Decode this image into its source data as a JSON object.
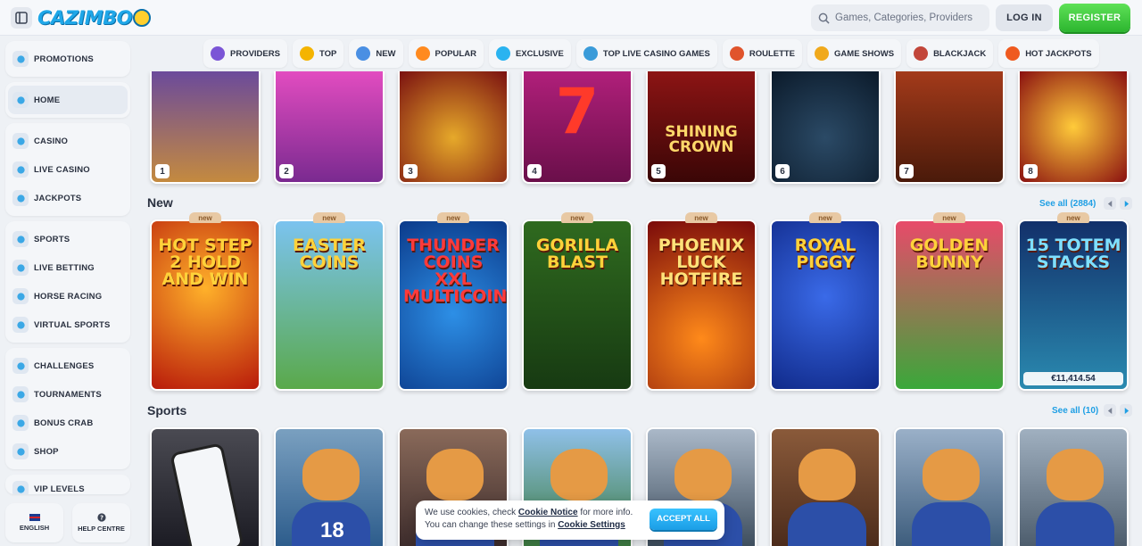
{
  "header": {
    "logo": "CAZIMBO",
    "search_placeholder": "Games, Categories, Providers",
    "login": "LOG IN",
    "register": "REGISTER"
  },
  "sidebar": {
    "groups": [
      [
        {
          "label": "PROMOTIONS",
          "icon": "gift-icon"
        }
      ],
      [
        {
          "label": "HOME",
          "icon": "home-icon",
          "active": true
        }
      ],
      [
        {
          "label": "CASINO",
          "icon": "slot-machine-icon"
        },
        {
          "label": "LIVE CASINO",
          "icon": "dealer-icon"
        },
        {
          "label": "JACKPOTS",
          "icon": "jackpot-icon"
        }
      ],
      [
        {
          "label": "SPORTS",
          "icon": "ball-icon"
        },
        {
          "label": "LIVE BETTING",
          "icon": "play-icon"
        },
        {
          "label": "HORSE RACING",
          "icon": "horse-icon"
        },
        {
          "label": "VIRTUAL SPORTS",
          "icon": "gamepad-icon"
        }
      ],
      [
        {
          "label": "CHALLENGES",
          "icon": "target-icon"
        },
        {
          "label": "TOURNAMENTS",
          "icon": "trophy-icon"
        },
        {
          "label": "BONUS CRAB",
          "icon": "crab-icon"
        },
        {
          "label": "SHOP",
          "icon": "shop-icon"
        }
      ],
      [
        {
          "label": "VIP LEVELS",
          "icon": "crown-icon"
        }
      ]
    ],
    "language": "ENGLISH",
    "help": "HELP CENTRE"
  },
  "categories": [
    {
      "label": "PROVIDERS",
      "color": "#7b55d6"
    },
    {
      "label": "TOP",
      "color": "#f4b400"
    },
    {
      "label": "NEW",
      "color": "#4a8fe3"
    },
    {
      "label": "POPULAR",
      "color": "#ff8a1f"
    },
    {
      "label": "EXCLUSIVE",
      "color": "#2ab3f0"
    },
    {
      "label": "TOP LIVE CASINO GAMES",
      "color": "#3a9bd9"
    },
    {
      "label": "ROULETTE",
      "color": "#e0542c"
    },
    {
      "label": "GAME SHOWS",
      "color": "#f0a91c"
    },
    {
      "label": "BLACKJACK",
      "color": "#c2463a"
    },
    {
      "label": "HOT JACKPOTS",
      "color": "#ef5a1f"
    }
  ],
  "top_games": {
    "tiles": [
      {
        "rank": "1",
        "title": "",
        "bg": "linear-gradient(#6b4a9b,#c48a3f)"
      },
      {
        "rank": "2",
        "title": "",
        "bg": "linear-gradient(#e24cc0,#7a2a90)"
      },
      {
        "rank": "3",
        "title": "",
        "bg": "radial-gradient(circle at 50% 60%,#e6a92a,#7a1010)"
      },
      {
        "rank": "4",
        "title": "7",
        "bg": "linear-gradient(#b01f7a,#6a0f4a)"
      },
      {
        "rank": "5",
        "title": "SHINING CROWN",
        "bg": "linear-gradient(#8c1414,#3a0606)"
      },
      {
        "rank": "6",
        "title": "",
        "bg": "radial-gradient(circle at 50% 60%,#2b4a66,#0b1a2a)"
      },
      {
        "rank": "7",
        "title": "",
        "bg": "linear-gradient(#a33a1a,#4a1a0a)"
      },
      {
        "rank": "8",
        "title": "",
        "bg": "radial-gradient(circle at 50% 50%,#ffcb3a,#8a1010)"
      }
    ]
  },
  "new_section": {
    "title": "New",
    "see_all": "See all (2884)",
    "badge": "new",
    "tiles": [
      {
        "title": "HOT STEP 2 HOLD AND WIN",
        "bg": "radial-gradient(circle at 50% 40%,#ffb12a,#b81a0a)",
        "color": "#ffd23a",
        "jackpot": ""
      },
      {
        "title": "EASTER COINS",
        "bg": "linear-gradient(#7bc3ef,#5aa94a)",
        "color": "#ffd23a",
        "jackpot": ""
      },
      {
        "title": "THUNDER COINS XXL MULTICOIN",
        "bg": "radial-gradient(circle at 50% 55%,#2d8fe6,#0b3a8a)",
        "color": "#ff3a3a",
        "jackpot": ""
      },
      {
        "title": "GORILLA BLAST",
        "bg": "linear-gradient(#2f6a1f,#173a12)",
        "color": "#ffd23a",
        "jackpot": ""
      },
      {
        "title": "PHOENIX LUCK HOTFIRE",
        "bg": "radial-gradient(circle at 50% 70%,#ff8a1a,#7a0a0a)",
        "color": "#ffe27a",
        "jackpot": ""
      },
      {
        "title": "ROYAL PIGGY",
        "bg": "radial-gradient(circle at 50% 45%,#3a6ae8,#102a8a)",
        "color": "#ffd23a",
        "jackpot": ""
      },
      {
        "title": "GOLDEN BUNNY",
        "bg": "linear-gradient(#e84a6a,#3aa83a)",
        "color": "#ffd23a",
        "jackpot": ""
      },
      {
        "title": "15 TOTEM STACKS",
        "bg": "linear-gradient(#12306a,#2a8ab0)",
        "color": "#7fe0ff",
        "jackpot": "€11,414.54"
      }
    ]
  },
  "sports_section": {
    "title": "Sports",
    "see_all": "See all (10)",
    "tiles": [
      {
        "bg": "linear-gradient(#4a4a52,#1a1a22)",
        "number": ""
      },
      {
        "bg": "linear-gradient(#7aa0c0,#2a5a8a)",
        "number": "18"
      },
      {
        "bg": "linear-gradient(#8a6a5a,#3a2a2a)",
        "number": ""
      },
      {
        "bg": "linear-gradient(#8fc0e8,#3a7a3a)",
        "number": ""
      },
      {
        "bg": "linear-gradient(#aab8c8,#3a4a5a)",
        "number": ""
      },
      {
        "bg": "linear-gradient(#8a5a3a,#4a2a1a)",
        "number": ""
      },
      {
        "bg": "linear-gradient(#9ab0c8,#3a5a7a)",
        "number": ""
      },
      {
        "bg": "linear-gradient(#a0b0c0,#4a5a6a)",
        "number": ""
      }
    ]
  },
  "cookie": {
    "line1_pre": "We use cookies, check ",
    "link1": "Cookie Notice",
    "line1_post": " for more info.",
    "line2_pre": "You can change these settings in ",
    "link2": "Cookie Settings",
    "accept": "ACCEPT ALL"
  }
}
